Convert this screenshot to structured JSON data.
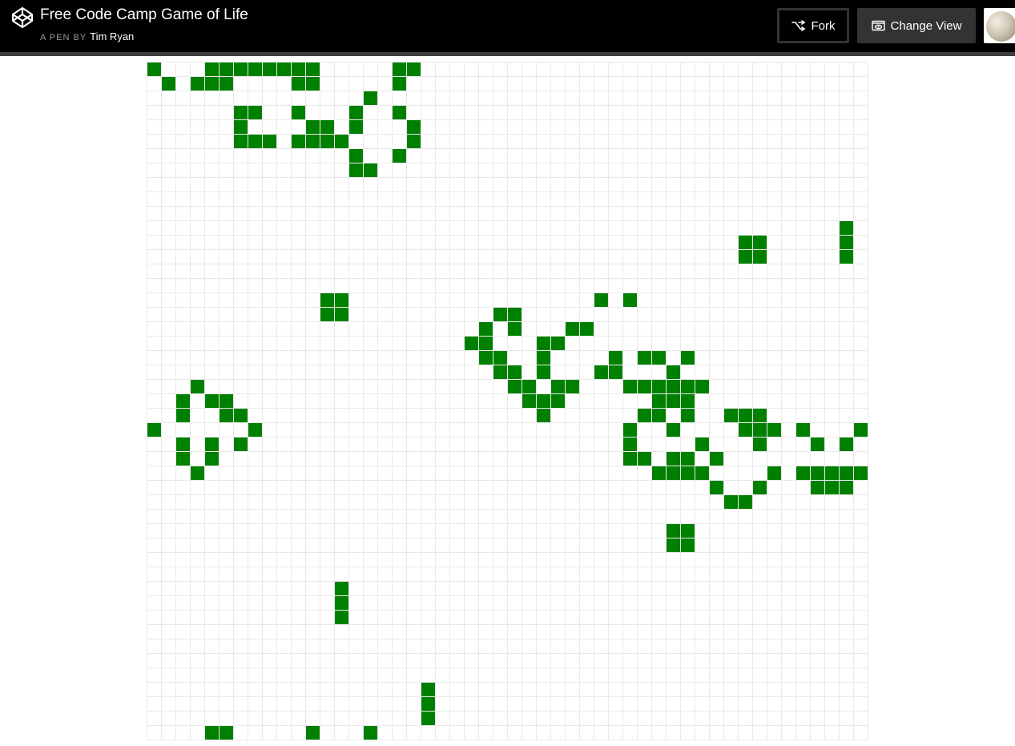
{
  "header": {
    "title": "Free Code Camp Game of Life",
    "byline_prefix": "A PEN BY",
    "author": "Tim Ryan",
    "fork_label": "Fork",
    "change_view_label": "Change View"
  },
  "board": {
    "columns": 50,
    "rows": 47,
    "live_color": "#008000",
    "grid_color": "#e9e9e9",
    "live_cells": [
      [
        0,
        0
      ],
      [
        0,
        4
      ],
      [
        0,
        5
      ],
      [
        0,
        6
      ],
      [
        0,
        7
      ],
      [
        0,
        8
      ],
      [
        0,
        9
      ],
      [
        0,
        10
      ],
      [
        0,
        11
      ],
      [
        0,
        17
      ],
      [
        0,
        18
      ],
      [
        1,
        1
      ],
      [
        1,
        3
      ],
      [
        1,
        4
      ],
      [
        1,
        5
      ],
      [
        1,
        10
      ],
      [
        1,
        11
      ],
      [
        1,
        17
      ],
      [
        2,
        15
      ],
      [
        3,
        6
      ],
      [
        3,
        7
      ],
      [
        3,
        10
      ],
      [
        3,
        14
      ],
      [
        3,
        17
      ],
      [
        4,
        6
      ],
      [
        4,
        11
      ],
      [
        4,
        12
      ],
      [
        4,
        14
      ],
      [
        4,
        18
      ],
      [
        5,
        6
      ],
      [
        5,
        7
      ],
      [
        5,
        8
      ],
      [
        5,
        10
      ],
      [
        5,
        11
      ],
      [
        5,
        12
      ],
      [
        5,
        13
      ],
      [
        5,
        18
      ],
      [
        6,
        14
      ],
      [
        6,
        17
      ],
      [
        7,
        14
      ],
      [
        7,
        15
      ],
      [
        11,
        48
      ],
      [
        12,
        41
      ],
      [
        12,
        42
      ],
      [
        12,
        48
      ],
      [
        13,
        41
      ],
      [
        13,
        42
      ],
      [
        13,
        48
      ],
      [
        16,
        12
      ],
      [
        16,
        13
      ],
      [
        16,
        31
      ],
      [
        16,
        33
      ],
      [
        17,
        12
      ],
      [
        17,
        13
      ],
      [
        17,
        24
      ],
      [
        17,
        25
      ],
      [
        18,
        23
      ],
      [
        18,
        25
      ],
      [
        18,
        29
      ],
      [
        18,
        30
      ],
      [
        19,
        22
      ],
      [
        19,
        23
      ],
      [
        19,
        27
      ],
      [
        19,
        28
      ],
      [
        20,
        23
      ],
      [
        20,
        24
      ],
      [
        20,
        27
      ],
      [
        20,
        32
      ],
      [
        20,
        34
      ],
      [
        20,
        35
      ],
      [
        20,
        37
      ],
      [
        21,
        24
      ],
      [
        21,
        25
      ],
      [
        21,
        27
      ],
      [
        21,
        31
      ],
      [
        21,
        32
      ],
      [
        21,
        36
      ],
      [
        22,
        3
      ],
      [
        22,
        25
      ],
      [
        22,
        26
      ],
      [
        22,
        28
      ],
      [
        22,
        29
      ],
      [
        22,
        33
      ],
      [
        22,
        34
      ],
      [
        22,
        35
      ],
      [
        22,
        36
      ],
      [
        22,
        37
      ],
      [
        22,
        38
      ],
      [
        23,
        2
      ],
      [
        23,
        4
      ],
      [
        23,
        5
      ],
      [
        23,
        26
      ],
      [
        23,
        27
      ],
      [
        23,
        28
      ],
      [
        23,
        35
      ],
      [
        23,
        36
      ],
      [
        23,
        37
      ],
      [
        24,
        2
      ],
      [
        24,
        5
      ],
      [
        24,
        6
      ],
      [
        24,
        27
      ],
      [
        24,
        34
      ],
      [
        24,
        35
      ],
      [
        24,
        37
      ],
      [
        24,
        40
      ],
      [
        24,
        41
      ],
      [
        24,
        42
      ],
      [
        25,
        0
      ],
      [
        25,
        7
      ],
      [
        25,
        33
      ],
      [
        25,
        36
      ],
      [
        25,
        41
      ],
      [
        25,
        42
      ],
      [
        25,
        43
      ],
      [
        25,
        45
      ],
      [
        25,
        49
      ],
      [
        26,
        2
      ],
      [
        26,
        4
      ],
      [
        26,
        6
      ],
      [
        26,
        33
      ],
      [
        26,
        38
      ],
      [
        26,
        42
      ],
      [
        26,
        46
      ],
      [
        26,
        48
      ],
      [
        27,
        2
      ],
      [
        27,
        4
      ],
      [
        27,
        33
      ],
      [
        27,
        34
      ],
      [
        27,
        36
      ],
      [
        27,
        37
      ],
      [
        27,
        39
      ],
      [
        28,
        3
      ],
      [
        28,
        35
      ],
      [
        28,
        36
      ],
      [
        28,
        37
      ],
      [
        28,
        38
      ],
      [
        28,
        43
      ],
      [
        28,
        45
      ],
      [
        28,
        46
      ],
      [
        28,
        47
      ],
      [
        28,
        48
      ],
      [
        28,
        49
      ],
      [
        29,
        39
      ],
      [
        29,
        42
      ],
      [
        29,
        46
      ],
      [
        29,
        47
      ],
      [
        29,
        48
      ],
      [
        30,
        40
      ],
      [
        30,
        41
      ],
      [
        32,
        36
      ],
      [
        32,
        37
      ],
      [
        33,
        36
      ],
      [
        33,
        37
      ],
      [
        36,
        13
      ],
      [
        37,
        13
      ],
      [
        38,
        13
      ],
      [
        43,
        19
      ],
      [
        44,
        19
      ],
      [
        45,
        19
      ],
      [
        46,
        4
      ],
      [
        46,
        5
      ],
      [
        46,
        11
      ],
      [
        46,
        15
      ],
      [
        47,
        3
      ],
      [
        47,
        4
      ],
      [
        47,
        5
      ],
      [
        47,
        7
      ],
      [
        47,
        15
      ]
    ]
  }
}
